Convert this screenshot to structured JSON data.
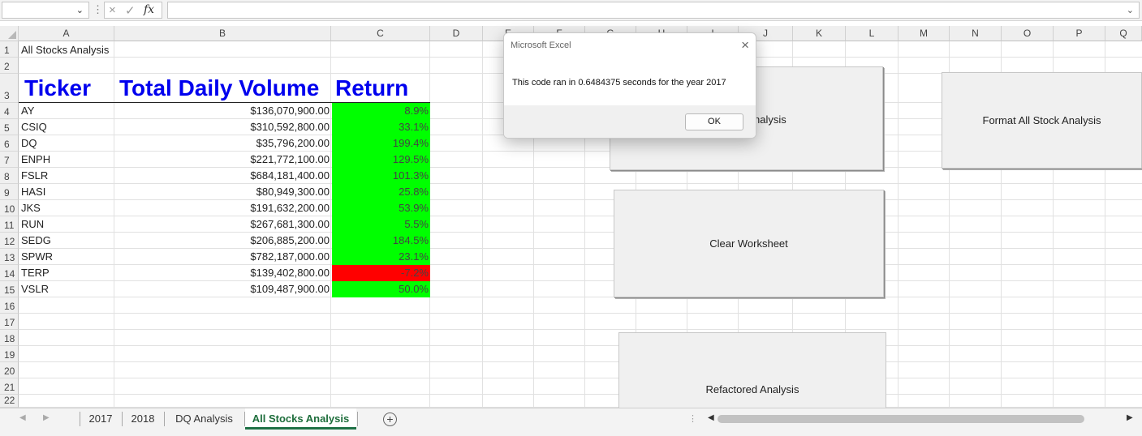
{
  "formula_bar": {
    "name_box": "",
    "dots_icon": "vertical-dots",
    "cancel_icon": "×",
    "confirm_icon": "✓",
    "fx_label": "fx",
    "content": ""
  },
  "columns": [
    "A",
    "B",
    "C",
    "D",
    "E",
    "F",
    "G",
    "H",
    "I",
    "J",
    "K",
    "L",
    "M",
    "N",
    "O",
    "P",
    "Q"
  ],
  "rows": [
    "1",
    "2",
    "3",
    "4",
    "5",
    "6",
    "7",
    "8",
    "9",
    "10",
    "11",
    "12",
    "13",
    "14",
    "15",
    "16",
    "17",
    "18",
    "19",
    "20",
    "21",
    "22"
  ],
  "sheet": {
    "title": "All Stocks Analysis",
    "headers": {
      "ticker": "Ticker",
      "volume": "Total Daily Volume",
      "return": "Return"
    },
    "data": [
      {
        "ticker": "AY",
        "volume": "$136,070,900.00",
        "return": "8.9%",
        "status": "positive"
      },
      {
        "ticker": "CSIQ",
        "volume": "$310,592,800.00",
        "return": "33.1%",
        "status": "positive"
      },
      {
        "ticker": "DQ",
        "volume": "$35,796,200.00",
        "return": "199.4%",
        "status": "positive"
      },
      {
        "ticker": "ENPH",
        "volume": "$221,772,100.00",
        "return": "129.5%",
        "status": "positive"
      },
      {
        "ticker": "FSLR",
        "volume": "$684,181,400.00",
        "return": "101.3%",
        "status": "positive"
      },
      {
        "ticker": "HASI",
        "volume": "$80,949,300.00",
        "return": "25.8%",
        "status": "positive"
      },
      {
        "ticker": "JKS",
        "volume": "$191,632,200.00",
        "return": "53.9%",
        "status": "positive"
      },
      {
        "ticker": "RUN",
        "volume": "$267,681,300.00",
        "return": "5.5%",
        "status": "positive"
      },
      {
        "ticker": "SEDG",
        "volume": "$206,885,200.00",
        "return": "184.5%",
        "status": "positive"
      },
      {
        "ticker": "SPWR",
        "volume": "$782,187,000.00",
        "return": "23.1%",
        "status": "positive"
      },
      {
        "ticker": "TERP",
        "volume": "$139,402,800.00",
        "return": "-7.2%",
        "status": "negative"
      },
      {
        "ticker": "VSLR",
        "volume": "$109,487,900.00",
        "return": "50.0%",
        "status": "positive"
      }
    ]
  },
  "colors": {
    "header_text": "#0000ee",
    "positive_fill": "#00ff00",
    "negative_fill": "#ff0000",
    "active_tab": "#1e7145"
  },
  "buttons": {
    "all_stocks_partial": "nalysis",
    "format": "Format All Stock Analysis",
    "clear": "Clear Worksheet",
    "refactored": "Refactored Analysis"
  },
  "dialog": {
    "title": "Microsoft Excel",
    "message": "This code ran in 0.6484375 seconds for the year 2017",
    "ok_label": "OK",
    "close_icon": "×"
  },
  "tabs": {
    "items": [
      "2017",
      "2018",
      "DQ Analysis",
      "All Stocks Analysis"
    ],
    "active": "All Stocks Analysis",
    "add_icon": "+"
  }
}
